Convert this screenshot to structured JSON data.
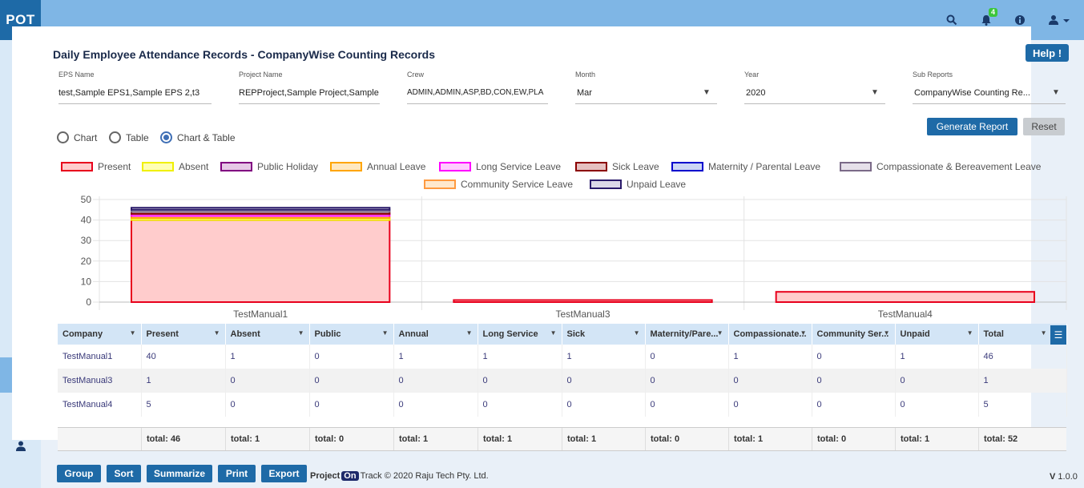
{
  "app": {
    "logo": "POT",
    "notifications_count": "4"
  },
  "page": {
    "title": "Daily Employee Attendance Records - CompanyWise Counting Records",
    "help_label": "Help !"
  },
  "filters": {
    "eps": {
      "label": "EPS Name",
      "value": "test,Sample EPS1,Sample EPS 2,t3"
    },
    "project": {
      "label": "Project Name",
      "value": "REPProject,Sample Project,Sample"
    },
    "crew": {
      "label": "Crew",
      "value": "ADMIN,ADMIN,ASP,BD,CON,EW,PLA"
    },
    "month": {
      "label": "Month",
      "value": "Mar"
    },
    "year": {
      "label": "Year",
      "value": "2020"
    },
    "sub_reports": {
      "label": "Sub Reports",
      "value": "CompanyWise Counting Re..."
    }
  },
  "view_options": {
    "chart": "Chart",
    "table": "Table",
    "chart_table": "Chart & Table",
    "selected": "chart_table"
  },
  "actions": {
    "generate": "Generate Report",
    "reset": "Reset"
  },
  "chart_data": {
    "type": "bar",
    "stacked": true,
    "categories": [
      "TestManual1",
      "TestManual3",
      "TestManual4"
    ],
    "ylim": [
      0,
      50
    ],
    "yticks": [
      0,
      10,
      20,
      30,
      40,
      50
    ],
    "series": [
      {
        "name": "Present",
        "values": [
          40,
          1,
          5
        ],
        "fill": "#ffcccc",
        "stroke": "#e8001c"
      },
      {
        "name": "Absent",
        "values": [
          1,
          0,
          0
        ],
        "fill": "#ffffb3",
        "stroke": "#f0f000"
      },
      {
        "name": "Public Holiday",
        "values": [
          0,
          0,
          0
        ],
        "fill": "#e6c8e6",
        "stroke": "#800080"
      },
      {
        "name": "Annual Leave",
        "values": [
          1,
          0,
          0
        ],
        "fill": "#ffe8c0",
        "stroke": "#ffa500"
      },
      {
        "name": "Long Service Leave",
        "values": [
          1,
          0,
          0
        ],
        "fill": "#ffccff",
        "stroke": "#ff00ff"
      },
      {
        "name": "Sick Leave",
        "values": [
          1,
          0,
          0
        ],
        "fill": "#e6c0c0",
        "stroke": "#8b0000"
      },
      {
        "name": "Maternity / Parental Leave",
        "values": [
          0,
          0,
          0
        ],
        "fill": "#ccd6f5",
        "stroke": "#0000cd"
      },
      {
        "name": "Compassionate & Bereavement Leave",
        "values": [
          1,
          0,
          0
        ],
        "fill": "#e6e0ea",
        "stroke": "#7b6a88"
      },
      {
        "name": "Community Service Leave",
        "values": [
          0,
          0,
          0
        ],
        "fill": "#ffe8cc",
        "stroke": "#ff9a40"
      },
      {
        "name": "Unpaid Leave",
        "values": [
          1,
          0,
          0
        ],
        "fill": "#dcd8e8",
        "stroke": "#2a1a6a"
      }
    ]
  },
  "table": {
    "headers": [
      "Company",
      "Present",
      "Absent",
      "Public",
      "Annual",
      "Long Service",
      "Sick",
      "Maternity/Pare...",
      "Compassionate...",
      "Community Ser...",
      "Unpaid",
      "Total"
    ],
    "rows": [
      [
        "TestManual1",
        "40",
        "1",
        "0",
        "1",
        "1",
        "1",
        "0",
        "1",
        "0",
        "1",
        "46"
      ],
      [
        "TestManual3",
        "1",
        "0",
        "0",
        "0",
        "0",
        "0",
        "0",
        "0",
        "0",
        "0",
        "1"
      ],
      [
        "TestManual4",
        "5",
        "0",
        "0",
        "0",
        "0",
        "0",
        "0",
        "0",
        "0",
        "0",
        "5"
      ]
    ],
    "totals": [
      "total: 46",
      "total: 1",
      "total: 0",
      "total: 1",
      "total: 1",
      "total: 1",
      "total: 0",
      "total: 1",
      "total: 0",
      "total: 1",
      "total: 52"
    ]
  },
  "footer": {
    "buttons": [
      "Group",
      "Sort",
      "Summarize",
      "Print",
      "Export"
    ],
    "brand_pre": "Project",
    "brand_on": "On",
    "brand_post": "Track © 2020 Raju Tech Pty. Ltd.",
    "version_v": "V",
    "version": "1.0.0"
  },
  "icons": {
    "sidebar": [
      "document-icon",
      "folder-icon",
      "folder-open-icon",
      "calendar-icon",
      "cart-icon",
      "users-icon",
      "database-icon",
      "piggy-bank-icon",
      "dashboard-icon",
      "list-icon",
      "check-square-icon",
      "user-icon"
    ]
  }
}
